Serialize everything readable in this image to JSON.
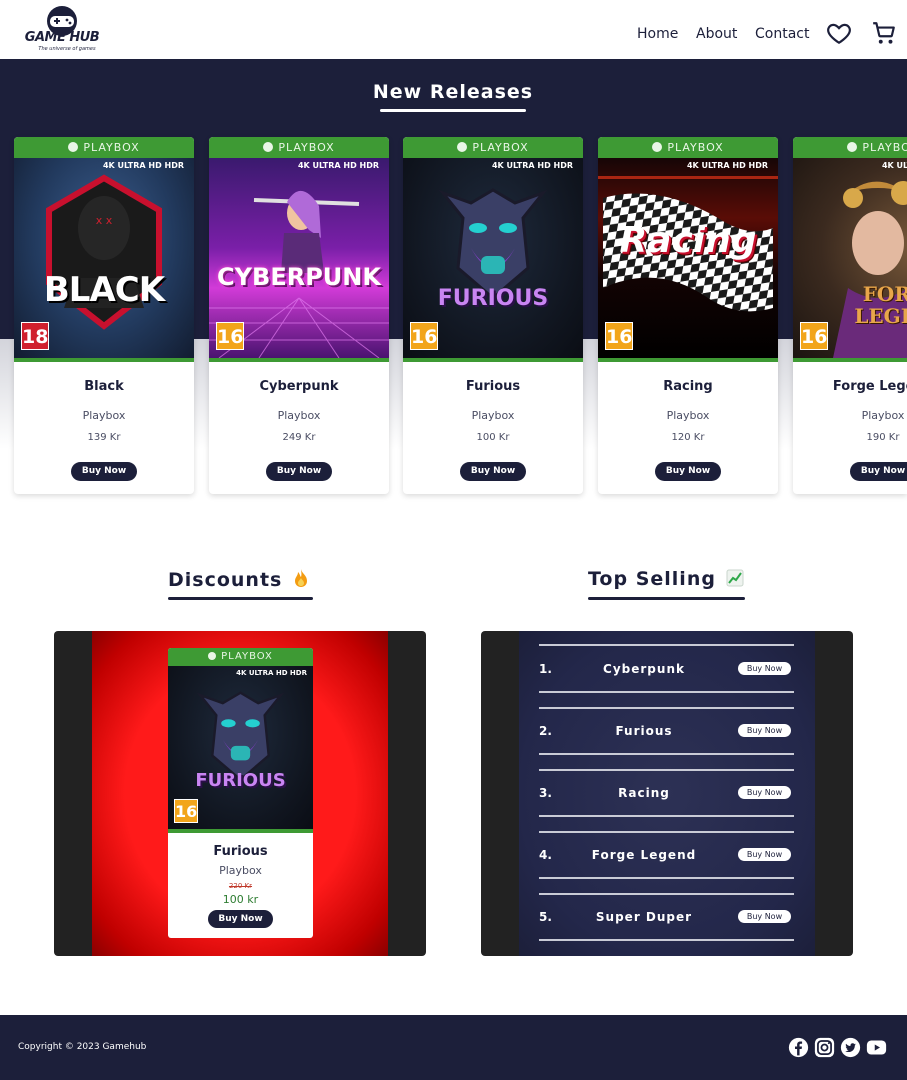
{
  "header": {
    "logo_text": "GAME HUB",
    "logo_tagline": "The universe of games",
    "nav": [
      "Home",
      "About",
      "Contact"
    ]
  },
  "new_releases": {
    "title": "New Releases",
    "platform_badge": "PLAYBOX",
    "hdr_badge": "4K ULTRA HD HDR",
    "buy_label": "Buy Now",
    "cards": [
      {
        "name": "Black",
        "platform": "Playbox",
        "price": "139 Kr",
        "age": "18",
        "cover_text": "BLACK"
      },
      {
        "name": "Cyberpunk",
        "platform": "Playbox",
        "price": "249 Kr",
        "age": "16",
        "cover_text": "CYBERPUNK"
      },
      {
        "name": "Furious",
        "platform": "Playbox",
        "price": "100 Kr",
        "age": "16",
        "cover_text": "FURIOUS"
      },
      {
        "name": "Racing",
        "platform": "Playbox",
        "price": "120 Kr",
        "age": "16",
        "cover_text": "Racing"
      },
      {
        "name": "Forge Legend",
        "platform": "Playbox",
        "price": "190 Kr",
        "age": "16",
        "cover_text": "FORGE LEGEND"
      }
    ]
  },
  "discounts": {
    "title": "Discounts",
    "icon": "fire-icon",
    "card": {
      "name": "Furious",
      "platform": "Playbox",
      "old_price": "220 Kr",
      "new_price": "100 kr",
      "age": "16",
      "cover_text": "FURIOUS",
      "buy_label": "Buy Now",
      "platform_badge": "PLAYBOX"
    }
  },
  "top_selling": {
    "title": "Top Selling",
    "icon": "chart-increasing-icon",
    "buy_label": "Buy Now",
    "items": [
      {
        "rank": "1.",
        "name": "Cyberpunk"
      },
      {
        "rank": "2.",
        "name": "Furious"
      },
      {
        "rank": "3.",
        "name": "Racing"
      },
      {
        "rank": "4.",
        "name": "Forge Legend"
      },
      {
        "rank": "5.",
        "name": "Super Duper"
      }
    ]
  },
  "footer": {
    "copyright": "Copyright © 2023 Gamehub",
    "social": [
      "facebook-icon",
      "instagram-icon",
      "twitter-icon",
      "youtube-icon"
    ]
  },
  "colors": {
    "navy": "#1c1f3a",
    "playbox_green": "#3e9a34",
    "discount_red": "#ff1a1a",
    "old_price_red": "#c0392b",
    "new_price_green": "#2e7d32"
  }
}
